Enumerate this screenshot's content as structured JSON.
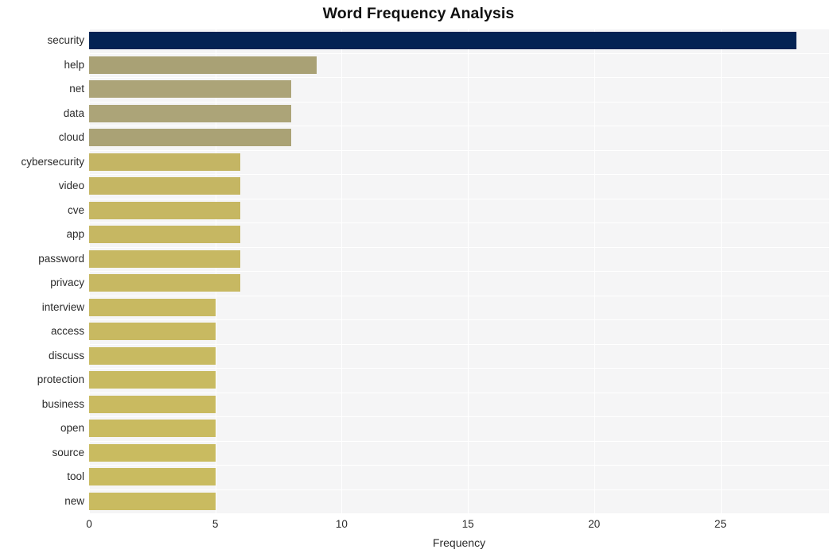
{
  "chart_data": {
    "type": "bar",
    "orientation": "horizontal",
    "title": "Word Frequency Analysis",
    "xlabel": "Frequency",
    "ylabel": "",
    "categories": [
      "security",
      "help",
      "net",
      "data",
      "cloud",
      "cybersecurity",
      "video",
      "cve",
      "app",
      "password",
      "privacy",
      "interview",
      "access",
      "discuss",
      "protection",
      "business",
      "open",
      "source",
      "tool",
      "new"
    ],
    "values": [
      28,
      9,
      8,
      8,
      8,
      6,
      6,
      6,
      6,
      6,
      6,
      5,
      5,
      5,
      5,
      5,
      5,
      5,
      5,
      5
    ],
    "bar_colors": [
      "#042354",
      "#a9a175",
      "#aca478",
      "#aca478",
      "#aaa275",
      "#c4b564",
      "#c5b663",
      "#c6b762",
      "#c6b762",
      "#c7b862",
      "#c7b862",
      "#c8b961",
      "#c8b961",
      "#c8ba61",
      "#c8ba61",
      "#c9ba60",
      "#c9bb60",
      "#c9bb60",
      "#c9bb60",
      "#c9bb60"
    ],
    "xlim": [
      0,
      29.3
    ],
    "xticks": [
      0,
      5,
      10,
      15,
      20,
      25
    ],
    "xtick_labels": [
      "0",
      "5",
      "10",
      "15",
      "20",
      "25"
    ],
    "grid": true,
    "grid_color": "#ffffff",
    "plot_background": "#f5f5f6",
    "figure_background": "#ffffff",
    "legend": null,
    "legend_position": "none"
  }
}
